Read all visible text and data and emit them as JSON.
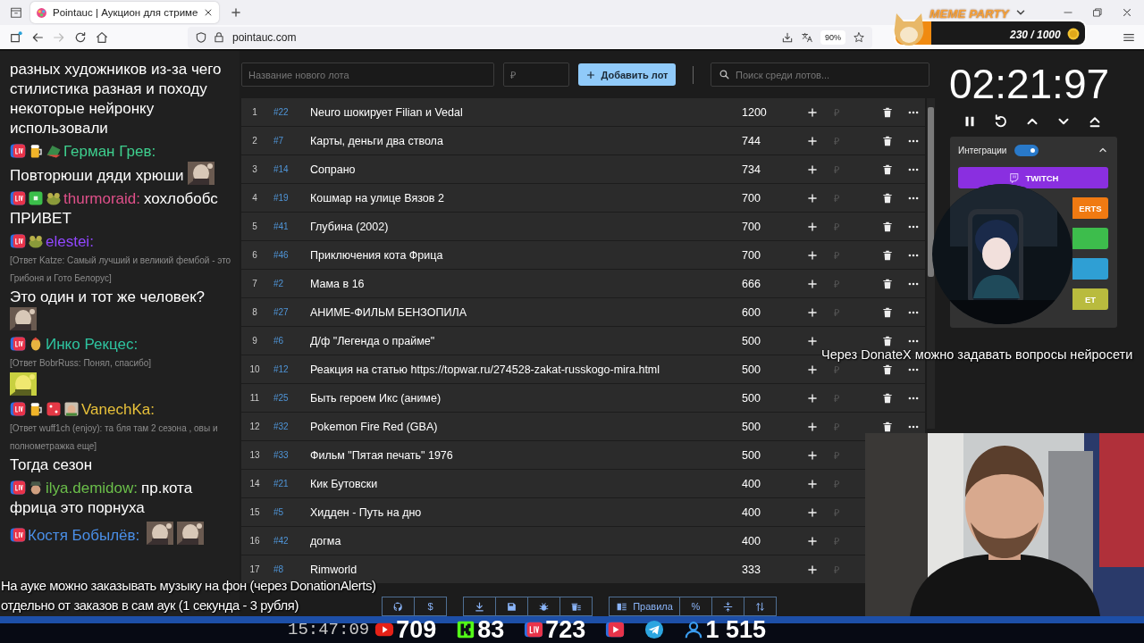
{
  "browser": {
    "tab_title": "Pointauc | Аукцион для стриме",
    "url": "pointauc.com",
    "zoom": "90%"
  },
  "overlay": {
    "meme_title": "MEME PARTY",
    "meme_progress": "230 / 1000",
    "note": "Через DonateX можно задавать вопросы нейросети",
    "subtitle": [
      "На ауке можно заказывать музыку на фон (через DonationAlerts)",
      "отдельно от заказов в сам аук (1 секунда - 3 рубля)"
    ]
  },
  "chat": {
    "messages": [
      {
        "lines": [
          {
            "text": "разных художников из-за чего стилистика разная и походу некоторые нейронку использовали"
          }
        ]
      },
      {
        "badges": [
          {
            "kind": "live"
          },
          {
            "kind": "beer"
          },
          {
            "kind": "hat"
          }
        ],
        "user": "Герман Грев:",
        "color": "#3ecf8e",
        "lines": [
          {
            "text": "Повторюши дяди хрюши",
            "emotes": [
              {
                "kind": "picture"
              }
            ]
          }
        ]
      },
      {
        "badges": [
          {
            "kind": "live"
          },
          {
            "kind": "square"
          },
          {
            "kind": "frog"
          }
        ],
        "user": "thurmoraid:",
        "color": "#e0508a",
        "head_text": "хохлобобс",
        "lines": [
          {
            "text": "ПРИВЕТ"
          }
        ]
      },
      {
        "badges": [
          {
            "kind": "live"
          },
          {
            "kind": "frog"
          }
        ],
        "user": "elestei:",
        "color": "#9147ff",
        "reply": "[Ответ Katze: Самый лучший и великий фембой - это Грибоня и Гото Белорус]",
        "lines": [
          {
            "text": "Это один и тот же человек?"
          },
          {
            "emotes": [
              {
                "kind": "picture"
              }
            ]
          }
        ]
      },
      {
        "badges": [
          {
            "kind": "live"
          },
          {
            "kind": "bird"
          }
        ],
        "user": "Инко Рекцес:",
        "color": "#2ec4a0",
        "reply": "[Ответ BobrRuss: Понял, спасибо]",
        "lines": [
          {
            "emotes": [
              {
                "kind": "sticker"
              }
            ]
          }
        ]
      },
      {
        "badges": [
          {
            "kind": "live"
          },
          {
            "kind": "beer"
          },
          {
            "kind": "dice"
          },
          {
            "kind": "face"
          }
        ],
        "user": "VanechKa:",
        "color": "#e8c13a",
        "reply": "[Ответ wuff1ch (enjoy): та бля там 2 сезона , овы и полнометражка еще]",
        "lines": [
          {
            "text": "Тогда сезон"
          }
        ]
      },
      {
        "badges": [
          {
            "kind": "live"
          },
          {
            "kind": "cap"
          }
        ],
        "user": "ilya.demidow:",
        "color": "#6bbf4a",
        "head_text": "пр.кота",
        "lines": [
          {
            "text": "фрица это порнуха"
          }
        ]
      },
      {
        "badges": [
          {
            "kind": "live"
          }
        ],
        "user": "Костя Бобылёв:",
        "color": "#4a8fe8",
        "emotes": [
          {
            "kind": "picture"
          },
          {
            "kind": "picture"
          }
        ]
      }
    ]
  },
  "lot_form": {
    "name_placeholder": "Название нового лота",
    "amount_placeholder": "₽",
    "add_button": "Добавить лот",
    "search_placeholder": "Поиск среди лотов..."
  },
  "lots": [
    {
      "index": "1",
      "id": "#22",
      "name": "Neuro шокирует Filian и Vedal",
      "amount": "1200",
      "currency": "₽",
      "actions": true
    },
    {
      "index": "2",
      "id": "#7",
      "name": "Карты, деньги два ствола",
      "amount": "744",
      "currency": "₽",
      "actions": true
    },
    {
      "index": "3",
      "id": "#14",
      "name": "Сопрано",
      "amount": "734",
      "currency": "₽",
      "actions": true
    },
    {
      "index": "4",
      "id": "#19",
      "name": "Кошмар на улице Вязов 2",
      "amount": "700",
      "currency": "₽",
      "actions": true
    },
    {
      "index": "5",
      "id": "#41",
      "name": "Глубина (2002)",
      "amount": "700",
      "currency": "₽",
      "actions": true
    },
    {
      "index": "6",
      "id": "#46",
      "name": "Приключения кота Фрица",
      "amount": "700",
      "currency": "₽",
      "actions": true
    },
    {
      "index": "7",
      "id": "#2",
      "name": "Мама в 16",
      "amount": "666",
      "currency": "₽",
      "actions": true
    },
    {
      "index": "8",
      "id": "#27",
      "name": "АНИМЕ-ФИЛЬМ БЕНЗОПИЛА",
      "amount": "600",
      "currency": "₽",
      "actions": true
    },
    {
      "index": "9",
      "id": "#6",
      "name": "Д/ф \"Легенда о прайме\"",
      "amount": "500",
      "actions": true
    },
    {
      "index": "10",
      "id": "#12",
      "name": "Реакция на статью https://topwar.ru/274528-zakat-russkogo-mira.html",
      "amount": "500",
      "currency": "₽",
      "actions": true
    },
    {
      "index": "11",
      "id": "#25",
      "name": "Быть героем Икс (аниме)",
      "amount": "500",
      "currency": "₽",
      "actions": true
    },
    {
      "index": "12",
      "id": "#32",
      "name": "Pokemon Fire Red (GBA)",
      "amount": "500",
      "currency": "₽",
      "actions": true
    },
    {
      "index": "13",
      "id": "#33",
      "name": "Фильм \"Пятая печать\" 1976",
      "amount": "500",
      "currency": "₽"
    },
    {
      "index": "14",
      "id": "#21",
      "name": "Кик Бутовски",
      "amount": "400",
      "currency": "₽"
    },
    {
      "index": "15",
      "id": "#5",
      "name": "Хидден - Путь на дно",
      "amount": "400",
      "currency": "₽"
    },
    {
      "index": "16",
      "id": "#42",
      "name": "догма",
      "amount": "400",
      "currency": "₽"
    },
    {
      "index": "17",
      "id": "#8",
      "name": "Rimworld",
      "amount": "333",
      "currency": "₽"
    }
  ],
  "toolbar": {
    "groups": [
      {
        "buttons": [
          {
            "kind": "icon"
          },
          {
            "kind": "text",
            "label": "$"
          }
        ]
      },
      {
        "buttons": [
          {
            "kind": "icon"
          },
          {
            "kind": "icon"
          },
          {
            "kind": "icon"
          },
          {
            "kind": "icon"
          }
        ]
      },
      {
        "buttons": [
          {
            "kind": "icon_text",
            "label": "Правила"
          },
          {
            "kind": "text",
            "label": "%"
          },
          {
            "kind": "icon"
          },
          {
            "kind": "icon"
          }
        ]
      }
    ]
  },
  "timer": {
    "time": "02:21:97"
  },
  "integrations": {
    "title": "Интеграции",
    "enabled": true,
    "expanded": true,
    "services": [
      {
        "label": "TWITCH",
        "color": "#8a2fe0"
      },
      {
        "label": "ERTS",
        "color": "#f07a12"
      },
      {
        "color": "#3dbd4c"
      },
      {
        "color": "#2f9fd4"
      },
      {
        "label": "ET",
        "color": "#b9bb3e"
      }
    ]
  },
  "stream_bar": {
    "clock": "15:47:09",
    "stats": [
      {
        "kind": "youtube",
        "count": "709"
      },
      {
        "kind": "kick",
        "count": "83"
      },
      {
        "kind": "live",
        "count": "723"
      },
      {
        "kind": "play"
      },
      {
        "kind": "telegram"
      },
      {
        "kind": "viewers",
        "count": "1 515"
      }
    ]
  }
}
